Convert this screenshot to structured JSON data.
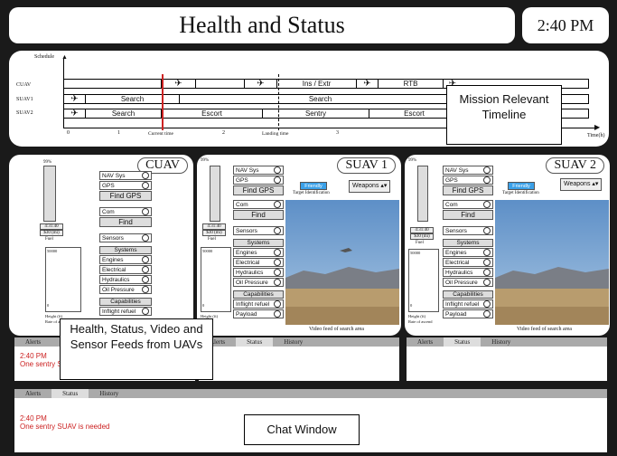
{
  "header": {
    "title": "Health and Status",
    "clock": "2:40 PM"
  },
  "timeline": {
    "schedule_label": "Schedule",
    "time_axis_label": "Time(h)",
    "ticks": [
      "0",
      "1",
      "2",
      "3"
    ],
    "current_time_label": "Current time",
    "landing_time_label": "Landing time",
    "rows": [
      {
        "label": "CUAV",
        "segments": [
          "Ins / Extr",
          "RTB"
        ]
      },
      {
        "label": "SUAV1",
        "segments": [
          "Search",
          "Search"
        ]
      },
      {
        "label": "SUAV2",
        "segments": [
          "Search",
          "Escort",
          "Sentry",
          "Escort"
        ]
      }
    ]
  },
  "callouts": {
    "timeline": "Mission Relevant Timeline",
    "feeds": "Health, Status, Video and Sensor Feeds from UAVs",
    "chat": "Chat Window"
  },
  "uavs": [
    {
      "name": "CUAV",
      "gauge_top": "99%",
      "fuel_time": "4:31:40",
      "fuel_amount": "$30 (mi)",
      "fuel_label": "Fuel",
      "alt_top": "50000",
      "alt_bottom": "0",
      "alt_label": "Height (ft)",
      "rate_label": "Rate of ascend",
      "nav_label": "NAV Sys",
      "gps_label": "GPS",
      "find_gps": "Find GPS",
      "com_label": "Com",
      "find_label": "Find",
      "sensors_label": "Sensors",
      "systems_label": "Systems",
      "systems": [
        "Engines",
        "Electrical",
        "Hydraulics",
        "Oil Pressure"
      ],
      "capabilities_label": "Capabilities",
      "capabilities": [
        "Inflight refuel"
      ]
    },
    {
      "name": "SUAV 1",
      "gauge_top": "99%",
      "fuel_time": "4:31:40",
      "fuel_amount": "$30 (mi)",
      "fuel_label": "Fuel",
      "alt_top": "50000",
      "alt_bottom": "0",
      "alt_label": "Height (ft)",
      "rate_label": "Rate of ascend",
      "nav_label": "NAV Sys",
      "gps_label": "GPS",
      "find_gps": "Find GPS",
      "com_label": "Com",
      "find_label": "Find",
      "sensors_label": "Sensors",
      "systems_label": "Systems",
      "systems": [
        "Engines",
        "Electrical",
        "Hydraulics",
        "Oil Pressure"
      ],
      "capabilities_label": "Capabilities",
      "capabilities": [
        "Inflight refuel",
        "Payload"
      ],
      "friendly_label": "Friendly",
      "target_id_label": "Target Identification",
      "weapons_label": "Weapons",
      "video_caption": "Video feed of search area"
    },
    {
      "name": "SUAV 2",
      "gauge_top": "99%",
      "fuel_time": "4:31:40",
      "fuel_amount": "$30 (mi)",
      "fuel_label": "Fuel",
      "alt_top": "50000",
      "alt_bottom": "0",
      "alt_label": "Height (ft)",
      "rate_label": "Rate of ascend",
      "nav_label": "NAV Sys",
      "gps_label": "GPS",
      "find_gps": "Find GPS",
      "com_label": "Com",
      "find_label": "Find",
      "sensors_label": "Sensors",
      "systems_label": "Systems",
      "systems": [
        "Engines",
        "Electrical",
        "Hydraulics",
        "Oil Pressure"
      ],
      "capabilities_label": "Capabilities",
      "capabilities": [
        "Inflight refuel",
        "Payload"
      ],
      "friendly_label": "Friendly",
      "target_id_label": "Target Identification",
      "weapons_label": "Weapons",
      "video_caption": "Video feed of search area"
    }
  ],
  "tabs": {
    "alerts": "Alerts",
    "status": "Status",
    "history": "History"
  },
  "alerts_panel": {
    "time": "2:40 PM",
    "message": "One sentry SUAV is needed"
  },
  "chat": {
    "time": "2:40 PM",
    "message": "One sentry SUAV is needed"
  },
  "colors": {
    "current_time_line": "#cc2222",
    "alert_text": "#cc2222",
    "friendly_badge": "#3aa0e8"
  }
}
